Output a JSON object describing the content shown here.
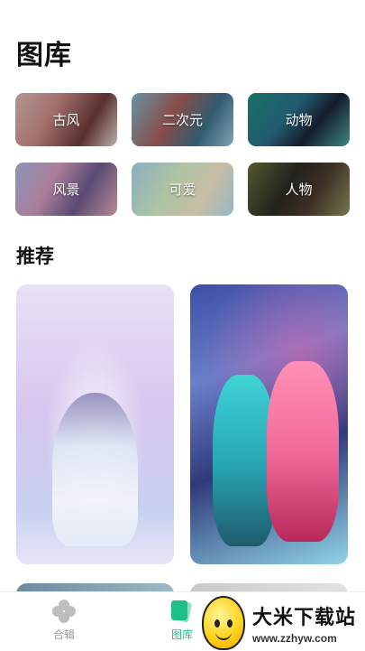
{
  "header": {
    "title": "图库"
  },
  "categories": [
    {
      "label": "古风"
    },
    {
      "label": "二次元"
    },
    {
      "label": "动物"
    },
    {
      "label": "风景"
    },
    {
      "label": "可爱"
    },
    {
      "label": "人物"
    }
  ],
  "recommend": {
    "title": "推荐"
  },
  "tabbar": {
    "items": [
      {
        "label": "合辑",
        "icon": "clover-icon",
        "active": false
      },
      {
        "label": "图库",
        "icon": "gallery-icon",
        "active": true
      }
    ],
    "active_color": "#1fbf8a",
    "inactive_color": "#9a9a9a"
  },
  "watermark": {
    "title": "大米下载站",
    "url": "www.zzhyw.com"
  }
}
